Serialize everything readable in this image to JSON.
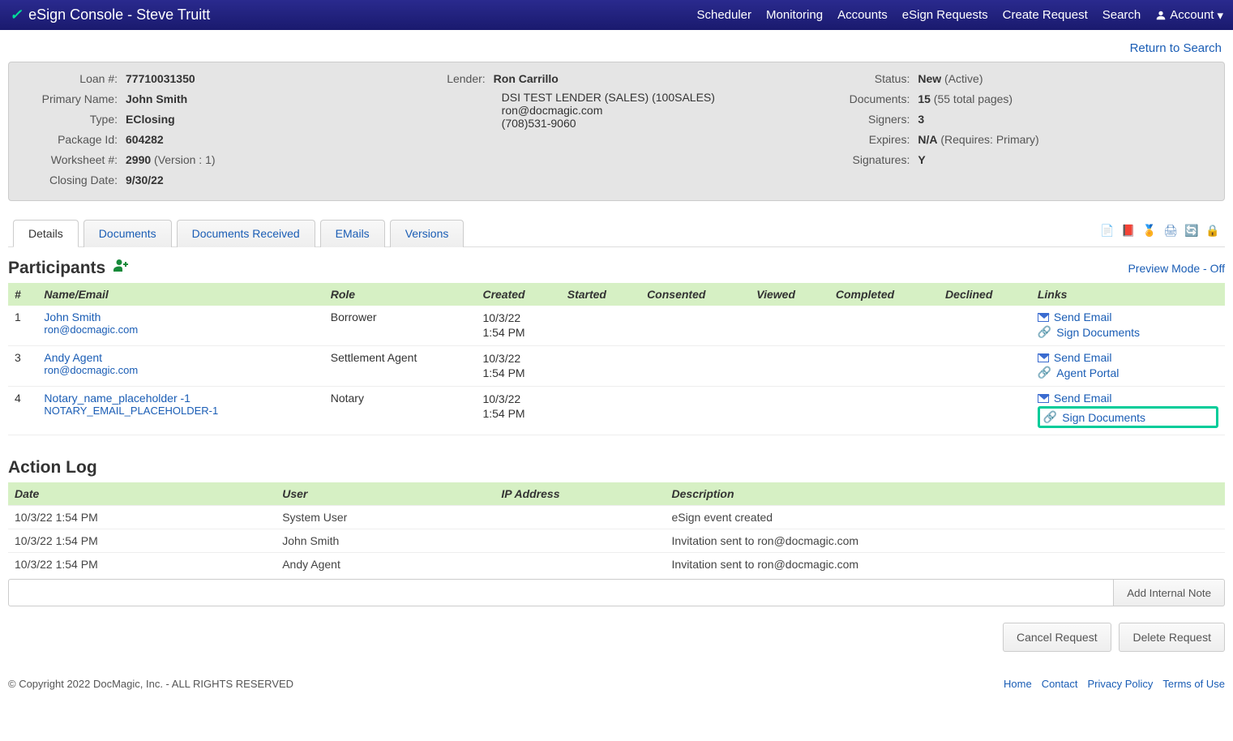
{
  "header": {
    "brand": "eSign Console - Steve Truitt",
    "nav": [
      "Scheduler",
      "Monitoring",
      "Accounts",
      "eSign Requests",
      "Create Request",
      "Search"
    ],
    "account_label": "Account"
  },
  "return_link": "Return to Search",
  "summary": {
    "left": {
      "loan_num_label": "Loan #:",
      "loan_num": "77710031350",
      "primary_name_label": "Primary Name:",
      "primary_name": "John Smith",
      "type_label": "Type:",
      "type_value": "EClosing",
      "package_id_label": "Package Id:",
      "package_id": "604282",
      "worksheet_label": "Worksheet #:",
      "worksheet": "2990",
      "worksheet_suffix": " (Version : 1)",
      "closing_date_label": "Closing Date:",
      "closing_date": "9/30/22"
    },
    "middle": {
      "lender_label": "Lender:",
      "lender_name": "Ron Carrillo",
      "lender_company": "DSI TEST LENDER (SALES) (100SALES)",
      "lender_email": "ron@docmagic.com",
      "lender_phone": "(708)531-9060"
    },
    "right": {
      "status_label": "Status:",
      "status": "New",
      "status_suffix": " (Active)",
      "documents_label": "Documents:",
      "documents": "15",
      "documents_suffix": " (55 total pages)",
      "signers_label": "Signers:",
      "signers": "3",
      "expires_label": "Expires:",
      "expires": "N/A",
      "expires_suffix": " (Requires: Primary)",
      "signatures_label": "Signatures:",
      "signatures": "Y"
    }
  },
  "tabs": [
    "Details",
    "Documents",
    "Documents Received",
    "EMails",
    "Versions"
  ],
  "active_tab": "Details",
  "participants": {
    "title": "Participants",
    "preview_toggle": "Preview Mode - Off",
    "columns": [
      "#",
      "Name/Email",
      "Role",
      "Created",
      "Started",
      "Consented",
      "Viewed",
      "Completed",
      "Declined",
      "Links"
    ],
    "rows": [
      {
        "num": "1",
        "name": "John Smith",
        "email": "ron@docmagic.com",
        "role": "Borrower",
        "created_date": "10/3/22",
        "created_time": "1:54 PM",
        "links": [
          {
            "icon": "envelope",
            "text": "Send Email"
          },
          {
            "icon": "link",
            "text": "Sign Documents"
          }
        ],
        "highlight": false
      },
      {
        "num": "3",
        "name": "Andy Agent",
        "email": "ron@docmagic.com",
        "role": "Settlement Agent",
        "created_date": "10/3/22",
        "created_time": "1:54 PM",
        "links": [
          {
            "icon": "envelope",
            "text": "Send Email"
          },
          {
            "icon": "link",
            "text": "Agent Portal"
          }
        ],
        "highlight": false
      },
      {
        "num": "4",
        "name": "Notary_name_placeholder -1",
        "email": "NOTARY_EMAIL_PLACEHOLDER-1",
        "role": "Notary",
        "created_date": "10/3/22",
        "created_time": "1:54 PM",
        "links": [
          {
            "icon": "envelope",
            "text": "Send Email"
          },
          {
            "icon": "link",
            "text": "Sign Documents",
            "highlight": true
          }
        ],
        "highlight": false
      }
    ]
  },
  "action_log": {
    "title": "Action Log",
    "columns": [
      "Date",
      "User",
      "IP Address",
      "Description"
    ],
    "rows": [
      {
        "date": "10/3/22 1:54 PM",
        "user": "System User",
        "ip": "",
        "desc": "eSign event created"
      },
      {
        "date": "10/3/22 1:54 PM",
        "user": "John Smith",
        "ip": "",
        "desc": "Invitation sent to ron@docmagic.com"
      },
      {
        "date": "10/3/22 1:54 PM",
        "user": "Andy Agent",
        "ip": "",
        "desc": "Invitation sent to ron@docmagic.com"
      }
    ],
    "note_placeholder": "",
    "add_note_btn": "Add Internal Note"
  },
  "buttons": {
    "cancel": "Cancel Request",
    "delete": "Delete Request"
  },
  "footer": {
    "copyright": "© Copyright 2022 DocMagic, Inc. - ALL RIGHTS RESERVED",
    "links": [
      "Home",
      "Contact",
      "Privacy Policy",
      "Terms of Use"
    ]
  }
}
